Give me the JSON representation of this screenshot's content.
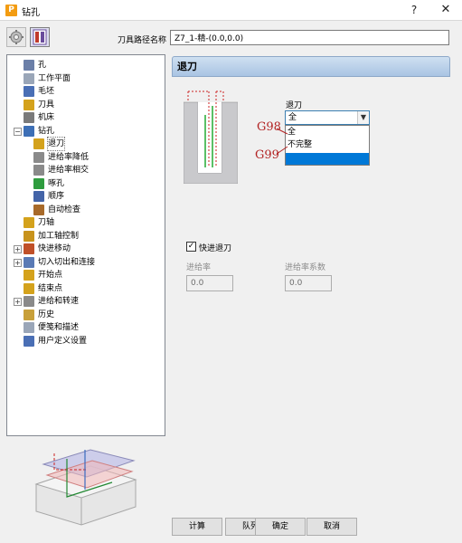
{
  "window": {
    "title": "钻孔",
    "help_glyph": "?",
    "close_glyph": "✕",
    "app_icon_letter": "P"
  },
  "toolpath_name": {
    "label": "刀具路径名称",
    "value": "Z7_1-精-(0.0,0.0)"
  },
  "tree": [
    {
      "label": "孔",
      "icon": "hole-icon",
      "color": "#6b7fa8",
      "expander": ""
    },
    {
      "label": "工作平面",
      "icon": "workplane-icon",
      "color": "#9aa6b8",
      "expander": ""
    },
    {
      "label": "毛坯",
      "icon": "block-icon",
      "color": "#4a6fb5",
      "expander": ""
    },
    {
      "label": "刀具",
      "icon": "tool-icon",
      "color": "#d4a21c",
      "expander": ""
    },
    {
      "label": "机床",
      "icon": "machine-icon",
      "color": "#7a7a7a",
      "expander": ""
    },
    {
      "label": "钻孔",
      "icon": "drill-icon",
      "color": "#3d6fb6",
      "expander": "−"
    },
    {
      "label": "退刀",
      "icon": "retract-icon",
      "color": "#d4a21c",
      "expander": "",
      "selected": true
    },
    {
      "label": "进给率降低",
      "icon": "feed-reduce-icon",
      "color": "#8a8a8a",
      "expander": ""
    },
    {
      "label": "进给率相交",
      "icon": "feed-intersect-icon",
      "color": "#8a8a8a",
      "expander": ""
    },
    {
      "label": "啄孔",
      "icon": "peck-icon",
      "color": "#2e9c3e",
      "expander": ""
    },
    {
      "label": "顺序",
      "icon": "order-icon",
      "color": "#4464a8",
      "expander": ""
    },
    {
      "label": "自动检查",
      "icon": "auto-verify-icon",
      "color": "#a86a2a",
      "expander": ""
    },
    {
      "label": "刀轴",
      "icon": "tool-axis-icon",
      "color": "#d4a21c",
      "expander": ""
    },
    {
      "label": "加工轴控制",
      "icon": "axis-control-icon",
      "color": "#c8931c",
      "expander": ""
    },
    {
      "label": "快进移动",
      "icon": "rapid-move-icon",
      "color": "#c05028",
      "expander": "+"
    },
    {
      "label": "切入切出和连接",
      "icon": "leads-links-icon",
      "color": "#5a7ab5",
      "expander": "+"
    },
    {
      "label": "开始点",
      "icon": "start-point-icon",
      "color": "#d4a21c",
      "expander": ""
    },
    {
      "label": "结束点",
      "icon": "end-point-icon",
      "color": "#d4a21c",
      "expander": ""
    },
    {
      "label": "进给和转速",
      "icon": "feeds-speeds-icon",
      "color": "#8a8a8a",
      "expander": "+"
    },
    {
      "label": "历史",
      "icon": "history-icon",
      "color": "#c8a03a",
      "expander": ""
    },
    {
      "label": "便笺和描述",
      "icon": "notes-icon",
      "color": "#9aa6b8",
      "expander": ""
    },
    {
      "label": "用户定义设置",
      "icon": "user-settings-icon",
      "color": "#4a6fb5",
      "expander": ""
    }
  ],
  "panel": {
    "title": "退刀",
    "retract": {
      "label": "退刀",
      "value": "全",
      "options": [
        "全",
        "不完整",
        ""
      ],
      "highlighted": "#0078d7"
    },
    "annotations": {
      "g98": "G98",
      "g99": "G99",
      "color": "#b22222"
    },
    "rapid_move": {
      "label": "快进退刀",
      "checked": true,
      "check_glyph": "✓"
    },
    "feed_rate": {
      "label": "进给率",
      "value": "0.0"
    },
    "feed_factor": {
      "label": "进给率系数",
      "value": "0.0"
    }
  },
  "buttons": {
    "calculate": "计算",
    "queue": "队列",
    "ok": "确定",
    "cancel": "取消"
  }
}
